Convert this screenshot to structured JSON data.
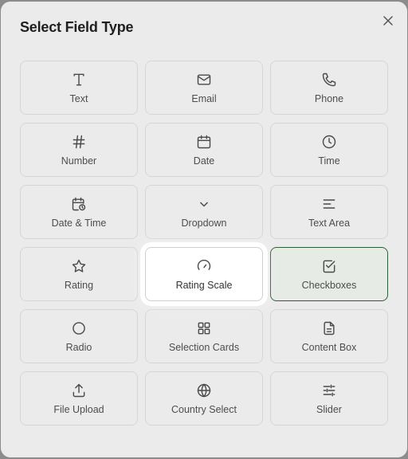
{
  "dialog": {
    "title": "Select Field Type",
    "close_icon": "close-icon"
  },
  "field_types": [
    {
      "label": "Text",
      "icon": "text-icon"
    },
    {
      "label": "Email",
      "icon": "mail-icon"
    },
    {
      "label": "Phone",
      "icon": "phone-icon"
    },
    {
      "label": "Number",
      "icon": "hash-icon"
    },
    {
      "label": "Date",
      "icon": "calendar-icon"
    },
    {
      "label": "Time",
      "icon": "clock-icon"
    },
    {
      "label": "Date & Time",
      "icon": "calendar-clock-icon"
    },
    {
      "label": "Dropdown",
      "icon": "chevron-down-icon"
    },
    {
      "label": "Text Area",
      "icon": "align-left-icon"
    },
    {
      "label": "Rating",
      "icon": "star-icon"
    },
    {
      "label": "Rating Scale",
      "icon": "gauge-icon",
      "highlighted": true
    },
    {
      "label": "Checkboxes",
      "icon": "check-square-icon",
      "selected": true
    },
    {
      "label": "Radio",
      "icon": "circle-icon"
    },
    {
      "label": "Selection Cards",
      "icon": "grid-icon"
    },
    {
      "label": "Content Box",
      "icon": "file-text-icon"
    },
    {
      "label": "File Upload",
      "icon": "upload-icon"
    },
    {
      "label": "Country Select",
      "icon": "globe-icon"
    },
    {
      "label": "Slider",
      "icon": "sliders-icon"
    }
  ],
  "colors": {
    "selected_border": "#2e5e36",
    "overlay": "#8c8c8c",
    "highlight": "#ffffff"
  }
}
